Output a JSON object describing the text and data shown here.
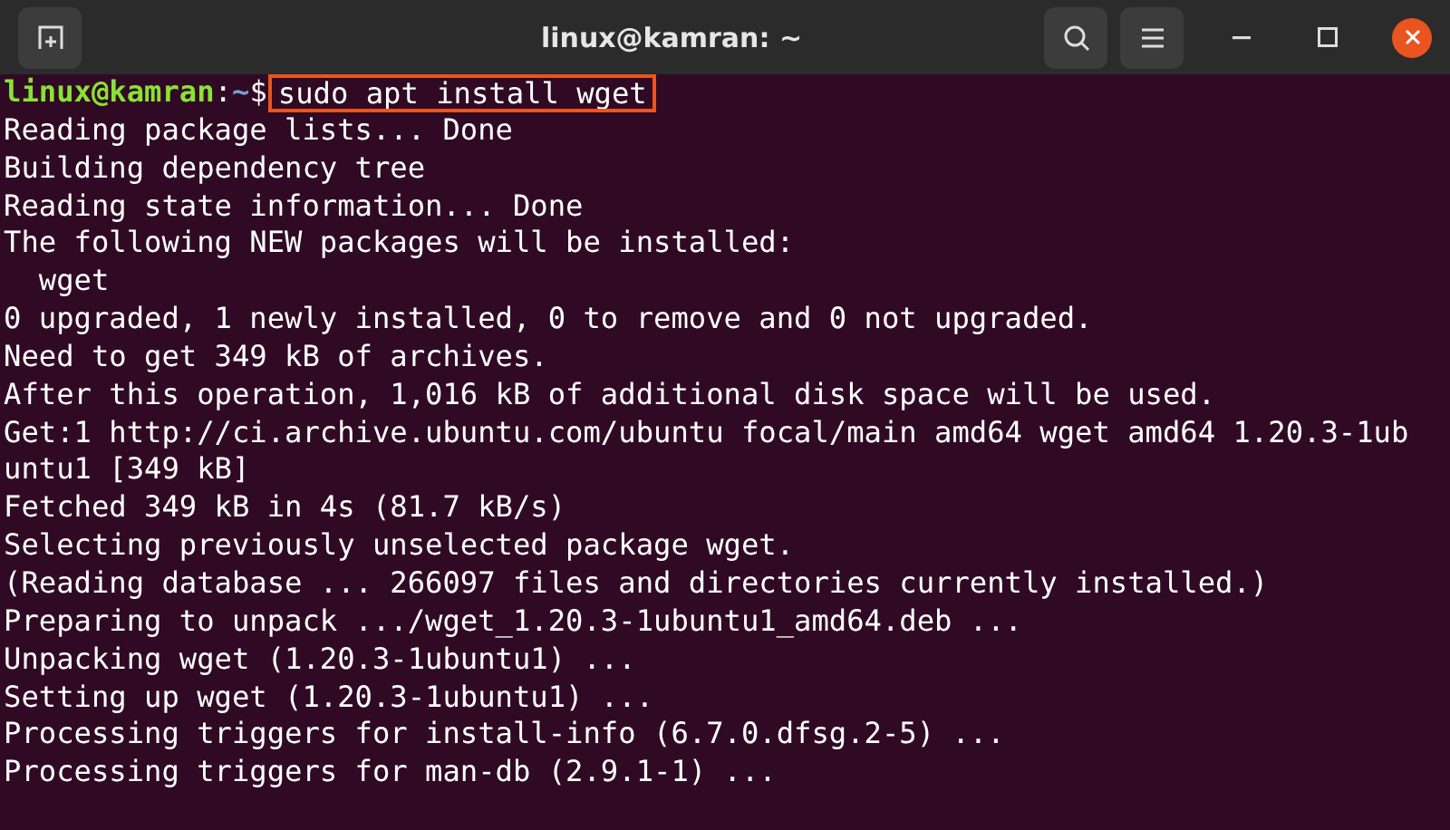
{
  "window": {
    "title": "linux@kamran: ~"
  },
  "prompt": {
    "user_host": "linux@kamran",
    "separator": ":",
    "path": "~",
    "symbol": "$"
  },
  "command": {
    "text": "sudo apt install wget",
    "highlighted": true
  },
  "output": [
    "Reading package lists... Done",
    "Building dependency tree",
    "Reading state information... Done",
    "The following NEW packages will be installed:",
    "  wget",
    "0 upgraded, 1 newly installed, 0 to remove and 0 not upgraded.",
    "Need to get 349 kB of archives.",
    "After this operation, 1,016 kB of additional disk space will be used.",
    "Get:1 http://ci.archive.ubuntu.com/ubuntu focal/main amd64 wget amd64 1.20.3-1ub",
    "untu1 [349 kB]",
    "Fetched 349 kB in 4s (81.7 kB/s)",
    "Selecting previously unselected package wget.",
    "(Reading database ... 266097 files and directories currently installed.)",
    "Preparing to unpack .../wget_1.20.3-1ubuntu1_amd64.deb ...",
    "Unpacking wget (1.20.3-1ubuntu1) ...",
    "Setting up wget (1.20.3-1ubuntu1) ...",
    "Processing triggers for install-info (6.7.0.dfsg.2-5) ...",
    "Processing triggers for man-db (2.9.1-1) ..."
  ]
}
